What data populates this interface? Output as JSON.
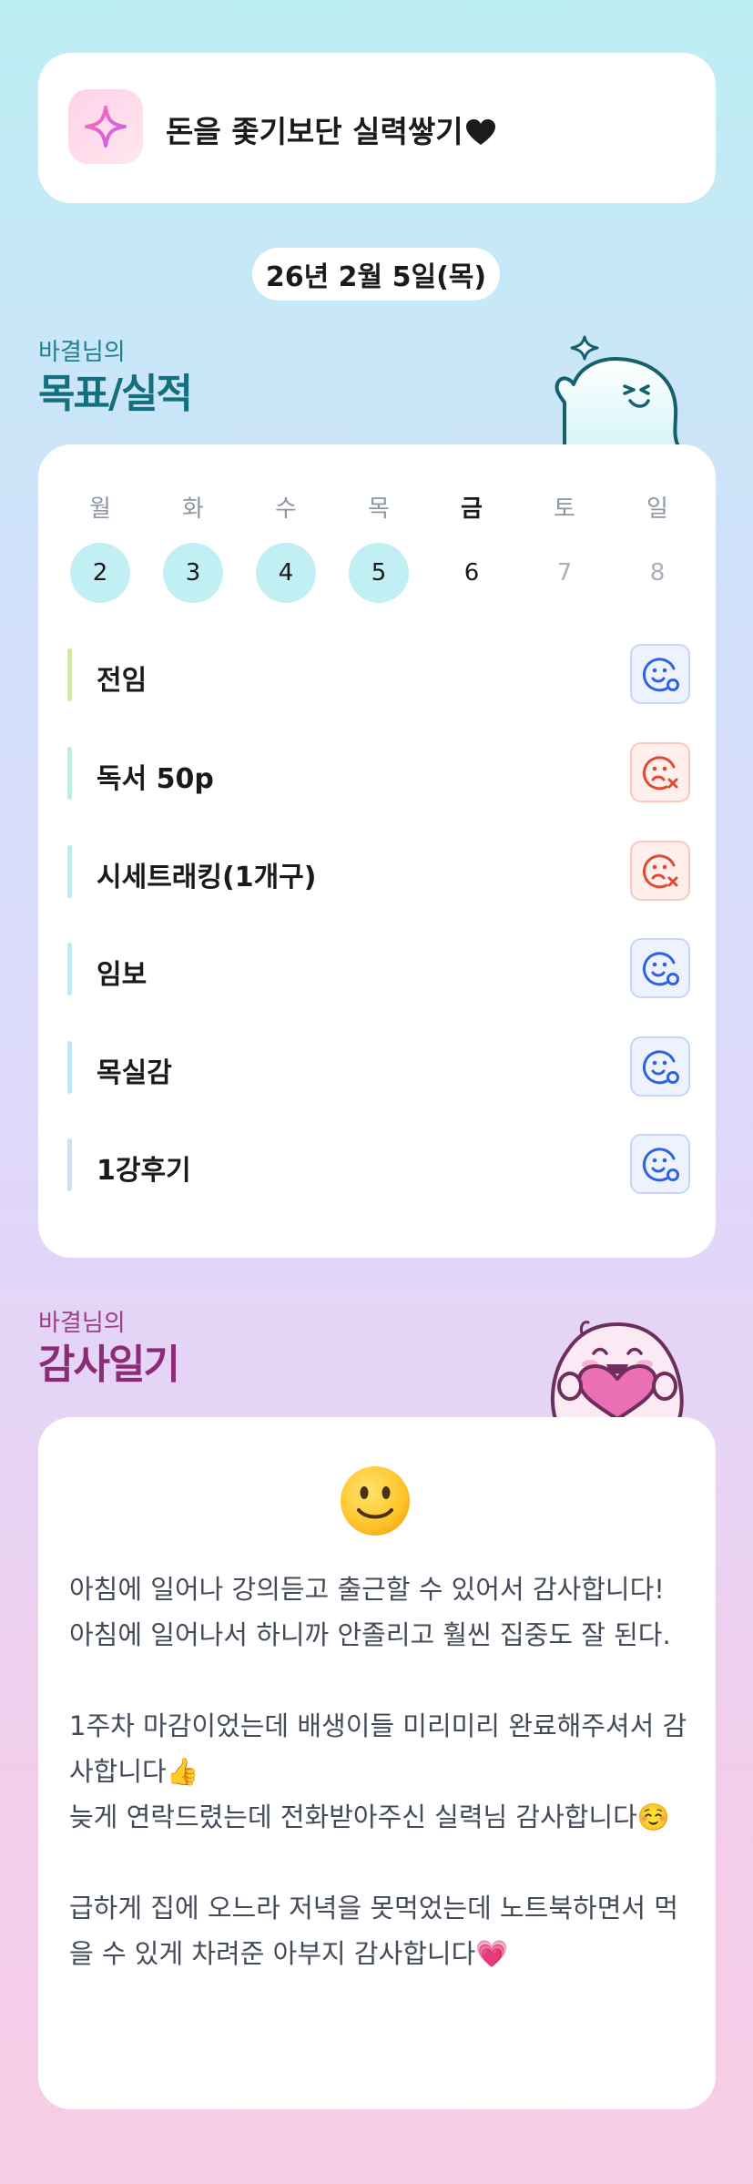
{
  "motto": {
    "text": "돈을 좇기보단 실력쌓기",
    "icon": "sparkle-star-icon",
    "trailing_icon": "black-heart-icon"
  },
  "date": {
    "label": "26년 2월 5일(목)"
  },
  "goals_section": {
    "owner": "바결님의",
    "title": "목표/실적"
  },
  "week": {
    "days": [
      {
        "weekday": "월",
        "date": "2",
        "state": "done"
      },
      {
        "weekday": "화",
        "date": "3",
        "state": "done"
      },
      {
        "weekday": "수",
        "date": "4",
        "state": "done"
      },
      {
        "weekday": "목",
        "date": "5",
        "state": "done"
      },
      {
        "weekday": "금",
        "date": "6",
        "state": "today"
      },
      {
        "weekday": "토",
        "date": "7",
        "state": "future"
      },
      {
        "weekday": "일",
        "date": "8",
        "state": "future"
      }
    ]
  },
  "goals": [
    {
      "label": "전임",
      "status": "achieved",
      "bar_color": "#cfe9a6"
    },
    {
      "label": "독서 50p",
      "status": "missed",
      "bar_color": "#bfeee3"
    },
    {
      "label": "시세트래킹(1개구)",
      "status": "missed",
      "bar_color": "#bfeaf0"
    },
    {
      "label": "임보",
      "status": "achieved",
      "bar_color": "#c2e9f2"
    },
    {
      "label": "목실감",
      "status": "achieved",
      "bar_color": "#c4e6f3"
    },
    {
      "label": "1강후기",
      "status": "achieved",
      "bar_color": "#cfe0f1"
    }
  ],
  "gratitude_section": {
    "owner": "바결님의",
    "title": "감사일기"
  },
  "gratitude": {
    "mood_icon": "slightly-smiling-face-icon",
    "text": "아침에 일어나 강의듣고 출근할 수 있어서 감사합니다! 아침에 일어나서 하니까 안졸리고 훨씬 집중도 잘 된다.\n\n1주차 마감이었는데 배생이들 미리미리 완료해주셔서 감사합니다👍\n늦게 연락드렸는데 전화받아주신 실력님 감사합니다☺️\n\n급하게 집에 오느라 저녁을 못먹었는데 노트북하면서 먹을 수 있게 차려준 아부지 감사합니다💗"
  },
  "colors": {
    "accent_teal": "#14707f",
    "accent_magenta": "#8c2c78",
    "done_day_bg": "#c2eff4",
    "achieved_icon": "#2d63e0",
    "missed_icon": "#e04a32"
  }
}
